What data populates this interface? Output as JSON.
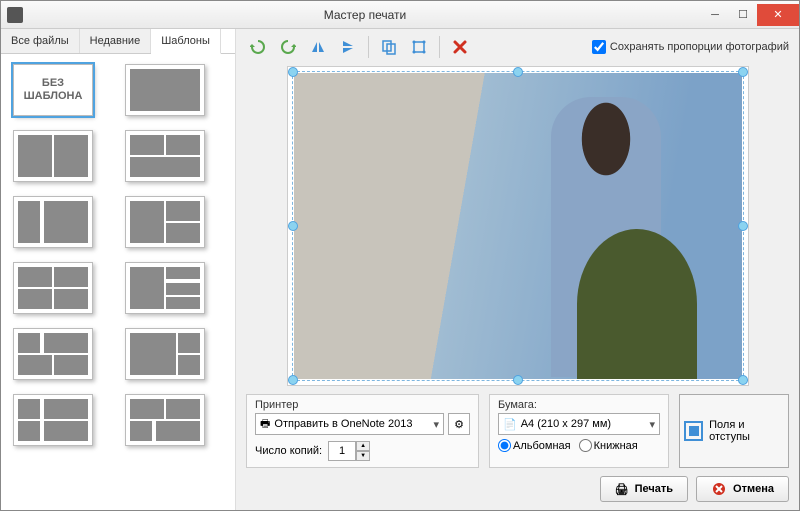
{
  "window": {
    "title": "Мастер печати"
  },
  "tabs": {
    "all": "Все файлы",
    "recent": "Недавние",
    "templates": "Шаблоны",
    "active_index": 2
  },
  "no_template_label": "БЕЗ\nШАБЛОНА",
  "keep_ratio": {
    "label": "Сохранять пропорции фотографий",
    "checked": true
  },
  "printer": {
    "group_label": "Принтер",
    "selected": "Отправить в OneNote 2013",
    "copies_label": "Число копий:",
    "copies_value": "1"
  },
  "paper": {
    "group_label": "Бумага:",
    "selected": "A4 (210 x 297 мм)",
    "orientation": {
      "landscape": "Альбомная",
      "portrait": "Книжная",
      "value": "landscape"
    }
  },
  "margins_button": "Поля и отступы",
  "actions": {
    "print": "Печать",
    "cancel": "Отмена"
  },
  "colors": {
    "accent": "#4fa3e0",
    "danger": "#e04b3a"
  }
}
